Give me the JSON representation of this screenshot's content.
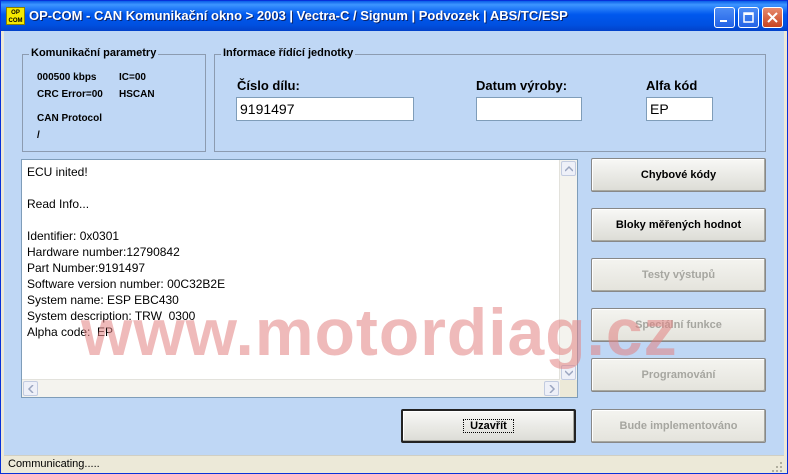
{
  "window": {
    "icon_text_top": "OP",
    "icon_text_bottom": "COM",
    "title": "OP-COM - CAN Komunikační okno > 2003 | Vectra-C / Signum | Podvozek | ABS/TC/ESP"
  },
  "comm_params": {
    "title": "Komunikační parametry",
    "baud": "000500 kbps",
    "ic": "IC=00",
    "crc": "CRC Error=00",
    "bus": "HSCAN",
    "protocol_label": "CAN Protocol",
    "protocol_value": "/"
  },
  "ecu_info": {
    "title": "Informace řídící jednotky",
    "part_label": "Číslo dílu:",
    "part_value": "9191497",
    "date_label": "Datum výroby:",
    "date_value": "",
    "alpha_label": "Alfa kód",
    "alpha_value": "EP"
  },
  "log": {
    "text": "ECU inited!\n\nRead Info...\n\nIdentifier: 0x0301\nHardware number:12790842\nPart Number:9191497\nSoftware version number: 00C32B2E\nSystem name: ESP EBC430\nSystem description: TRW  0300\nAlpha code:  EP"
  },
  "buttons": {
    "fault_codes": "Chybové kódy",
    "measured_blocks": "Bloky měřených hodnot",
    "output_tests": "Testy výstupů",
    "special_functions": "Speciální funkce",
    "programming": "Programování",
    "close": "Uzavřít",
    "future": "Bude implementováno"
  },
  "watermark": "www.motordiag.cz",
  "status": {
    "text": "Communicating....."
  },
  "colors": {
    "client_bg": "#BFD7F5",
    "titlebar": "#0058EE",
    "watermark": "#E18282"
  }
}
